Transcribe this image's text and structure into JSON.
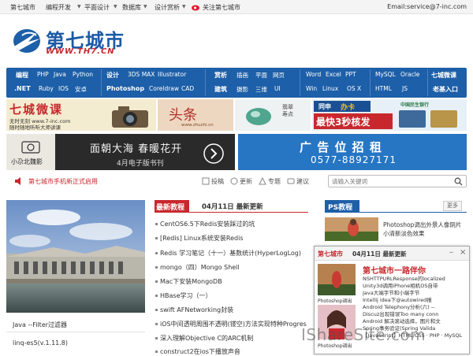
{
  "topbar": {
    "links": [
      "第七城市",
      "编程开发",
      "平面设计",
      "数据库",
      "设计赏析",
      "关注第七城市"
    ],
    "email": "Email:service@7-inc.com"
  },
  "logo": {
    "cn": "第七城市",
    "en": "WWW.TH7.CN"
  },
  "nav": {
    "row1": [
      "编程",
      "PHP",
      "Java",
      "Python",
      "设计",
      "3DS MAX",
      "Illustrator",
      "赏析",
      "插画",
      "平面",
      "网页",
      "Word",
      "Excel",
      "PPT",
      "MySQL",
      "Oracle",
      "七城微课"
    ],
    "row2": [
      ".NET",
      "Ruby",
      "IOS",
      "安卓",
      "Photoshop",
      "Coreldraw",
      "CAD",
      "建筑",
      "摄影",
      "三维",
      "UI",
      "Win",
      "Linux",
      "OS X",
      "HTML",
      "JS",
      "老基入口"
    ]
  },
  "ads": {
    "ad1_title": "七城微课",
    "ad1_sub1": "无时无刻 www.7-inc.com",
    "ad1_sub2": "随时随地听听大师讲课",
    "ad2_text": "头条",
    "ad2_url": "www.zhuzhi.cn",
    "ad3_text": "翡翠寿点",
    "ad4_line1": "同申",
    "ad4_line2": "办卡",
    "ad4_big": "最快3秒核发",
    "ad4_bank": "中国民生银行",
    "ad5_left": "小尕北魏影",
    "ad5_title": "面朝大海 春暖花开",
    "ad5_sub": "4月电子版书刊",
    "ad6_title": "广 告 位 招 租",
    "ad6_phone": "0577-88927171"
  },
  "newsbar": {
    "headline": "第七城市手机新正式启用",
    "tools": [
      "投稿",
      "更新",
      "专题",
      "建议"
    ],
    "search_placeholder": "请输入关键词"
  },
  "left": {
    "caption1": "Java --Filter过滤器",
    "caption2": "linq-es5(v.1.11.8)"
  },
  "middle": {
    "tag": "最新教程",
    "date": "04月11日 最新更新",
    "items": [
      "CentOS6.5下Redis安装踩过的坑",
      "[Redis] Linux系统安装Redis",
      "Redis 学习笔记（十一）基数统计(HyperLogLog)",
      "mongo（四）Mongo Shell",
      "Mac下安装MongoDB",
      "HBase学习（一）",
      "swift AFNetworking封装",
      "iOS中间透明周围不透明(镂空)方法实现特种Progres",
      "深入理解Objective C的ARC机制",
      "construct2在ios下播放声音"
    ]
  },
  "right": {
    "tag": "PS教程",
    "more": "更多",
    "desc": "Photoshop调出外景人像阴片小清新淡色效果"
  },
  "popup": {
    "brand": "第七城市",
    "date": "04月11日 最新更新",
    "title": "第七城市一路伴你",
    "lines": [
      "NSHTTPURLResponse的localized",
      "Unity3d调用iPhone相机OS自带",
      "Java大端字节和小端字节",
      "Intellij idea下@autowired报",
      "Android Telephony分析(六) --",
      "Discuz出现错误Too many conn",
      "Android 解决滚动选择，图片和文",
      "Spring事务验证(Spring Valida",
      "【JavaScript】HTML/CSS · PHP · MySQL"
    ],
    "thumb1": "Photoshop调出",
    "thumb2": "Photoshop调出",
    "controls": [
      "minimize",
      "close"
    ]
  },
  "watermark": "IShareSite.com",
  "colors": {
    "brand": "#1d5fa8",
    "red": "#c8282d",
    "accent": "#d33"
  }
}
